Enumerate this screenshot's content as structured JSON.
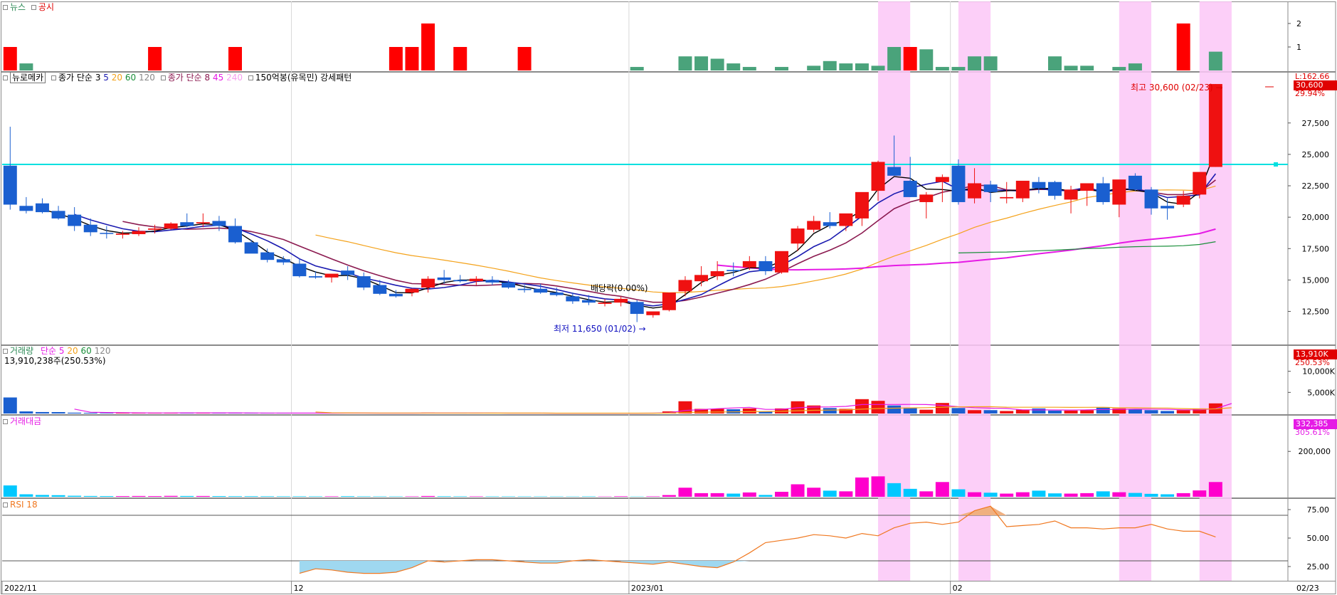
{
  "colors": {
    "up": "#ef1111",
    "down": "#1a5fd0",
    "highlight": "#fcc7f7",
    "ma3": "#000000",
    "ma5": "#1a1ab0",
    "ma20": "#f4a21a",
    "ma60": "#1a8f3a",
    "ma8": "#8b1a50",
    "ma45": "#e51ae5",
    "news": "#4aa37b",
    "disclosure": "#ff0000",
    "amount_up": "#ff00cc",
    "amount_down": "#00c8ff",
    "rsi": "#f07820",
    "rsi_fill_low": "#9fd8f0",
    "rsi_fill_high": "#f0b080",
    "resistance": "#00e0e0"
  },
  "news_panel": {
    "legend_news": "뉴스",
    "legend_disclosure": "공시",
    "y_ticks": [
      "2",
      "1"
    ]
  },
  "price_panel": {
    "legend_stock": "뉴로메카",
    "legend_ma_a_label": "종가 단순",
    "legend_ma_a_periods": [
      "3",
      "5",
      "20",
      "60",
      "120"
    ],
    "legend_ma_b_label": "종가 단순",
    "legend_ma_b_periods": [
      "8",
      "45",
      "240"
    ],
    "legend_pattern": "150억봉(유목민) 강세패턴",
    "y_ticks": [
      "27,500",
      "25,000",
      "22,500",
      "20,000",
      "17,500",
      "15,000",
      "12,500"
    ],
    "current_label": "30,600",
    "current_pct": "29.94%",
    "top_label": "L:162.66",
    "high_annotation": "최고 30,600 (02/23)",
    "low_annotation": "최저 11,650 (01/02)",
    "dividend_annotation": "배당락(0.00%)"
  },
  "volume_panel": {
    "legend_title": "거래량",
    "legend_ma_label": "단순",
    "legend_periods": [
      "5",
      "20",
      "60",
      "120"
    ],
    "legend_value": "13,910,238주(250.53%)",
    "y_ticks": [
      "10,000K",
      "5,000K"
    ],
    "current_label": "13,910K",
    "current_pct": "250.53%"
  },
  "amount_panel": {
    "legend_title": "거래대금",
    "y_ticks": [
      "200,000"
    ],
    "current_label": "332,385",
    "current_pct": "305.61%"
  },
  "rsi_panel": {
    "legend_title": "RSI 18",
    "y_ticks": [
      "75.00",
      "50.00",
      "25.00"
    ]
  },
  "x_axis": {
    "labels": [
      "2022/11",
      "12",
      "2023/01",
      "02",
      "02/23"
    ]
  },
  "chart_data": {
    "type": "candlestick",
    "dates": [
      "11/07",
      "11/08",
      "11/09",
      "11/10",
      "11/11",
      "11/14",
      "11/15",
      "11/16",
      "11/17",
      "11/18",
      "11/21",
      "11/22",
      "11/23",
      "11/24",
      "11/25",
      "11/28",
      "11/29",
      "11/30",
      "12/01",
      "12/02",
      "12/05",
      "12/06",
      "12/07",
      "12/08",
      "12/09",
      "12/12",
      "12/13",
      "12/14",
      "12/15",
      "12/16",
      "12/19",
      "12/20",
      "12/21",
      "12/22",
      "12/23",
      "12/26",
      "12/27",
      "12/28",
      "12/29",
      "01/02",
      "01/03",
      "01/04",
      "01/05",
      "01/06",
      "01/09",
      "01/10",
      "01/11",
      "01/12",
      "01/13",
      "01/16",
      "01/17",
      "01/18",
      "01/19",
      "01/20",
      "01/25",
      "01/26",
      "01/27",
      "01/30",
      "01/31",
      "02/01",
      "02/02",
      "02/03",
      "02/06",
      "02/07",
      "02/08",
      "02/09",
      "02/10",
      "02/13",
      "02/14",
      "02/15",
      "02/16",
      "02/17",
      "02/20",
      "02/21",
      "02/22",
      "02/23"
    ],
    "open": [
      24100,
      20900,
      21100,
      20500,
      20200,
      19400,
      18750,
      18600,
      18650,
      19000,
      19100,
      19600,
      19500,
      19700,
      19300,
      18000,
      17200,
      16650,
      16300,
      15300,
      15200,
      15750,
      15300,
      14600,
      13900,
      14000,
      14400,
      15200,
      15000,
      14900,
      15000,
      14800,
      14300,
      14300,
      14000,
      13700,
      13400,
      13100,
      13200,
      13250,
      12200,
      12600,
      14100,
      14900,
      15300,
      15800,
      16000,
      16500,
      15600,
      17900,
      19000,
      19600,
      19300,
      19900,
      22100,
      24000,
      22900,
      21200,
      22800,
      24100,
      21500,
      22600,
      21500,
      21500,
      22800,
      22800,
      21400,
      22100,
      22700,
      21000,
      23300,
      22200,
      20900,
      21000,
      21800,
      24000
    ],
    "high": [
      27200,
      21600,
      21500,
      20900,
      20800,
      19900,
      19300,
      18900,
      19200,
      19400,
      19600,
      20300,
      20300,
      20100,
      19900,
      18200,
      17500,
      16900,
      16700,
      15700,
      15400,
      16100,
      15600,
      15000,
      14200,
      14300,
      15300,
      15800,
      15400,
      15300,
      15300,
      15000,
      14600,
      14700,
      14400,
      14000,
      13800,
      13500,
      13700,
      13400,
      12400,
      13600,
      15300,
      16100,
      16500,
      16400,
      16900,
      16900,
      17100,
      19300,
      20100,
      20400,
      20100,
      21400,
      24500,
      26500,
      24800,
      22000,
      23400,
      24600,
      23900,
      22900,
      22800,
      22800,
      23200,
      22900,
      22500,
      22400,
      23200,
      22600,
      23500,
      22400,
      21500,
      22100,
      22800,
      30600
    ],
    "low": [
      20600,
      20300,
      20300,
      19800,
      18900,
      18500,
      18300,
      18300,
      18500,
      18700,
      19000,
      19200,
      19200,
      18900,
      17900,
      17200,
      16400,
      16200,
      15200,
      15100,
      14800,
      15000,
      14200,
      13800,
      13600,
      13700,
      14000,
      14700,
      14800,
      14600,
      14600,
      14300,
      14000,
      13900,
      13700,
      13100,
      13000,
      12900,
      12900,
      11650,
      12000,
      12500,
      13700,
      14500,
      15000,
      15300,
      15800,
      15400,
      15500,
      17300,
      18800,
      19100,
      18900,
      19300,
      21300,
      23600,
      21600,
      19900,
      21200,
      21000,
      21100,
      21200,
      21100,
      21200,
      21900,
      21400,
      20300,
      20900,
      21000,
      20000,
      22100,
      20200,
      19800,
      20800,
      21500,
      24000
    ],
    "close": [
      21000,
      20500,
      20400,
      19900,
      19300,
      18800,
      18700,
      18700,
      18900,
      19100,
      19500,
      19300,
      19600,
      19300,
      18000,
      17100,
      16600,
      16400,
      15300,
      15200,
      15500,
      15400,
      14400,
      13900,
      13700,
      14300,
      15100,
      15000,
      14900,
      15100,
      14800,
      14400,
      14200,
      14000,
      13800,
      13300,
      13200,
      13200,
      13500,
      12300,
      12500,
      14000,
      15000,
      15400,
      15700,
      15700,
      16500,
      15700,
      17300,
      19100,
      19700,
      19300,
      20300,
      22000,
      24400,
      23300,
      21600,
      21800,
      23200,
      21200,
      22700,
      22000,
      21600,
      22900,
      22300,
      21700,
      22200,
      22700,
      21200,
      23000,
      22200,
      20700,
      20700,
      21700,
      23600,
      30600
    ],
    "volume": [
      3800,
      500,
      350,
      340,
      200,
      160,
      120,
      130,
      150,
      130,
      180,
      160,
      150,
      130,
      110,
      120,
      100,
      90,
      90,
      80,
      90,
      130,
      80,
      70,
      60,
      90,
      200,
      120,
      90,
      80,
      80,
      80,
      70,
      70,
      60,
      60,
      80,
      60,
      100,
      60,
      100,
      500,
      2900,
      1100,
      1100,
      1000,
      1200,
      500,
      1200,
      2900,
      1900,
      1300,
      1100,
      3400,
      3000,
      1900,
      1400,
      900,
      2500,
      1300,
      800,
      800,
      600,
      900,
      1200,
      700,
      700,
      800,
      1400,
      1200,
      1000,
      800,
      600,
      800,
      1200,
      2400,
      6800
    ],
    "amount": [
      50000,
      11000,
      8000,
      7000,
      4500,
      3500,
      3000,
      3000,
      3500,
      3000,
      4000,
      3500,
      3500,
      3000,
      2500,
      2500,
      2200,
      2000,
      2000,
      1800,
      1900,
      2600,
      1800,
      1600,
      1500,
      1700,
      3500,
      2200,
      1800,
      1700,
      1600,
      1600,
      1500,
      1400,
      1300,
      1200,
      1600,
      1200,
      2200,
      1100,
      1800,
      7500,
      40000,
      16000,
      16000,
      14000,
      19000,
      8000,
      22000,
      55000,
      40000,
      27000,
      24000,
      85000,
      90000,
      60000,
      35000,
      24000,
      65000,
      33000,
      20000,
      18000,
      14000,
      20000,
      27000,
      15000,
      14000,
      16000,
      24000,
      20000,
      17000,
      13000,
      11000,
      16000,
      28000,
      65000,
      332385
    ],
    "news": [
      0,
      0.3,
      0,
      0,
      0,
      0,
      0,
      0,
      0,
      0.3,
      0,
      0,
      0,
      0,
      0,
      0,
      0,
      0,
      0,
      0,
      0,
      0,
      0,
      0,
      0,
      0,
      0,
      0,
      0,
      0,
      0,
      0,
      0,
      0,
      0,
      0,
      0,
      0,
      0,
      0.15,
      0,
      0,
      0.6,
      0.6,
      0.5,
      0.3,
      0.15,
      0,
      0.15,
      0,
      0.2,
      0.4,
      0.3,
      0.3,
      0.2,
      1,
      0,
      0.9,
      0.15,
      0.15,
      0.6,
      0.6,
      0,
      0,
      0,
      0.6,
      0.2,
      0.2,
      0,
      0.15,
      0.3,
      0,
      0,
      0,
      0,
      0.8,
      1
    ],
    "disclosure": [
      1,
      0,
      0,
      0,
      0,
      0,
      0,
      0,
      0,
      1,
      0,
      0,
      0,
      0,
      1,
      0,
      0,
      0,
      0,
      0,
      0,
      0,
      0,
      0,
      1,
      1,
      2,
      0,
      1,
      0,
      0,
      0,
      1,
      0,
      0,
      0,
      0,
      0,
      0,
      0,
      0,
      0,
      0,
      0,
      0,
      0,
      0,
      0,
      0,
      0,
      0,
      0,
      0,
      0,
      0,
      0,
      1,
      0,
      0,
      0,
      0,
      0,
      0,
      0,
      0,
      0,
      0,
      0,
      0,
      0,
      0,
      0,
      0,
      2,
      0,
      0,
      1
    ],
    "rsi": [
      null,
      null,
      null,
      null,
      null,
      null,
      null,
      null,
      null,
      null,
      null,
      null,
      null,
      null,
      null,
      null,
      null,
      null,
      19,
      23,
      22,
      20,
      19,
      19,
      20,
      24,
      30,
      29,
      30,
      31,
      31,
      30,
      29,
      28,
      28,
      30,
      31,
      30,
      29,
      28,
      27,
      29,
      27,
      25,
      24,
      29,
      37,
      46,
      48,
      50,
      53,
      52,
      50,
      54,
      52,
      59,
      63,
      64,
      62,
      64,
      74,
      78,
      60,
      61,
      62,
      65,
      59,
      59,
      58,
      59,
      59,
      62,
      58,
      56,
      56,
      51,
      57,
      55,
      52,
      51,
      51,
      51,
      55,
      55,
      54,
      60,
      71
    ],
    "highlight_days": [
      "01/26",
      "02/02",
      "02/16",
      "02/23"
    ],
    "y_range": [
      11000,
      31000
    ],
    "resistance_level": 24200
  }
}
